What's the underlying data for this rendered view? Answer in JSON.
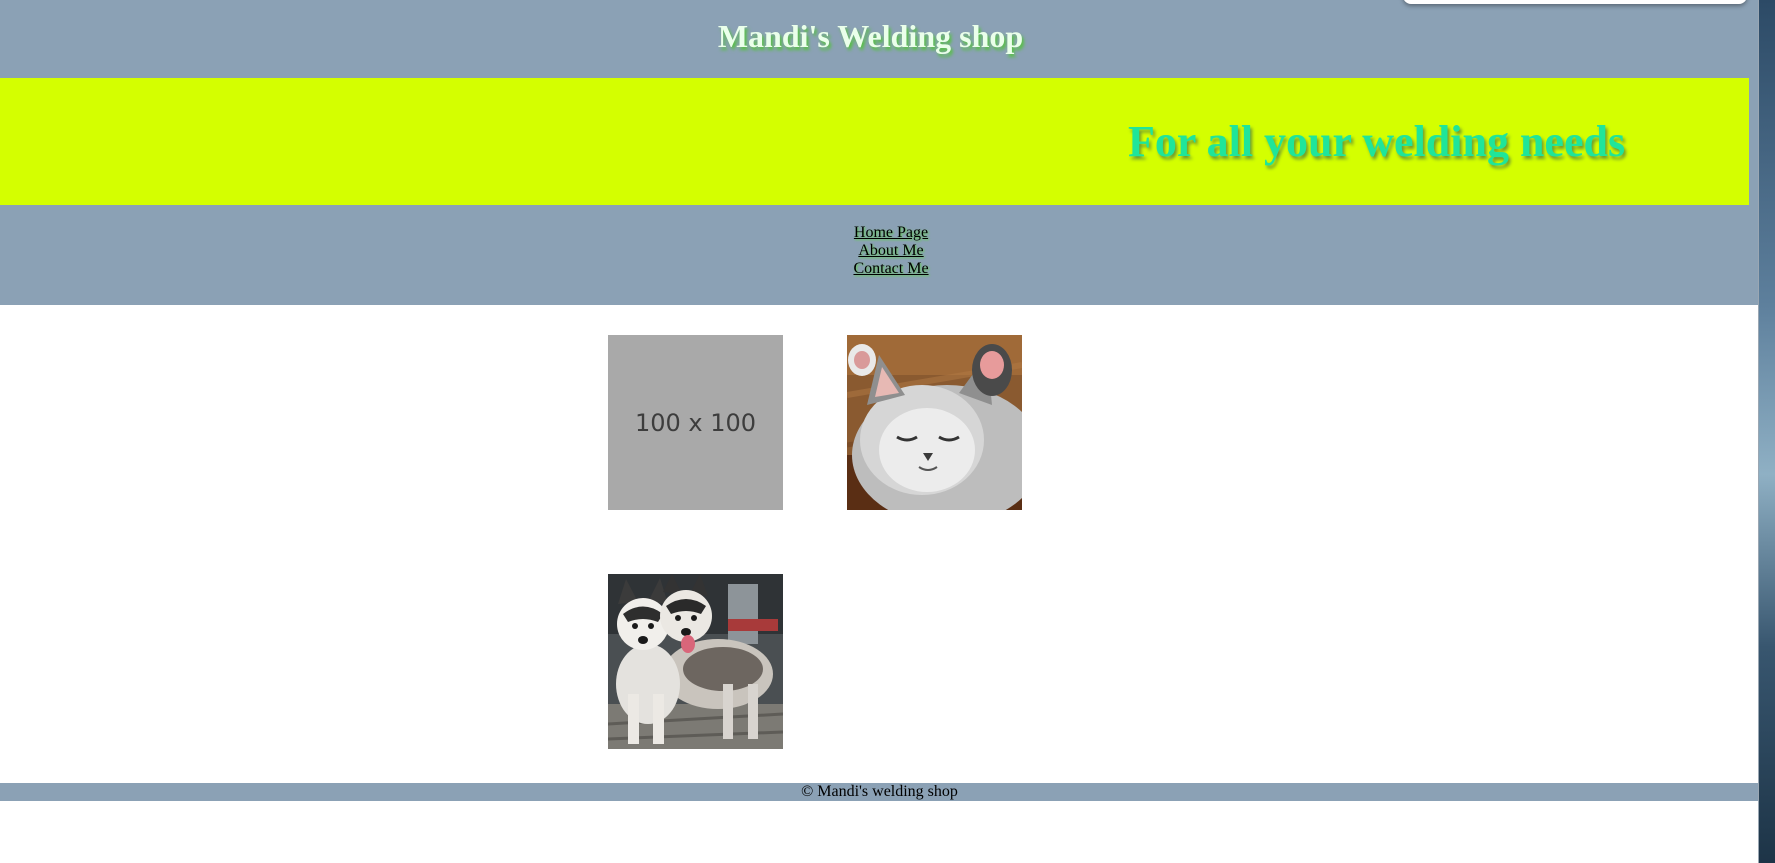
{
  "header": {
    "title": "Mandi's Welding shop",
    "tagline": "For all your welding needs"
  },
  "nav": {
    "items": [
      {
        "label": "Home Page"
      },
      {
        "label": "About Me"
      },
      {
        "label": "Contact Me"
      }
    ]
  },
  "gallery": {
    "placeholder_text": "100 x 100",
    "images": [
      {
        "icon": "placeholder-image"
      },
      {
        "icon": "kitten-photo"
      },
      {
        "icon": "husky-dogs-photo"
      }
    ]
  },
  "footer": {
    "text": "© Mandi's welding shop"
  },
  "colors": {
    "header_bg": "#8ba1b5",
    "banner_bg": "#d4ff00",
    "title_color": "#eaffea",
    "tagline_color": "#1fe59a",
    "placeholder_bg": "#a9a9a9"
  }
}
